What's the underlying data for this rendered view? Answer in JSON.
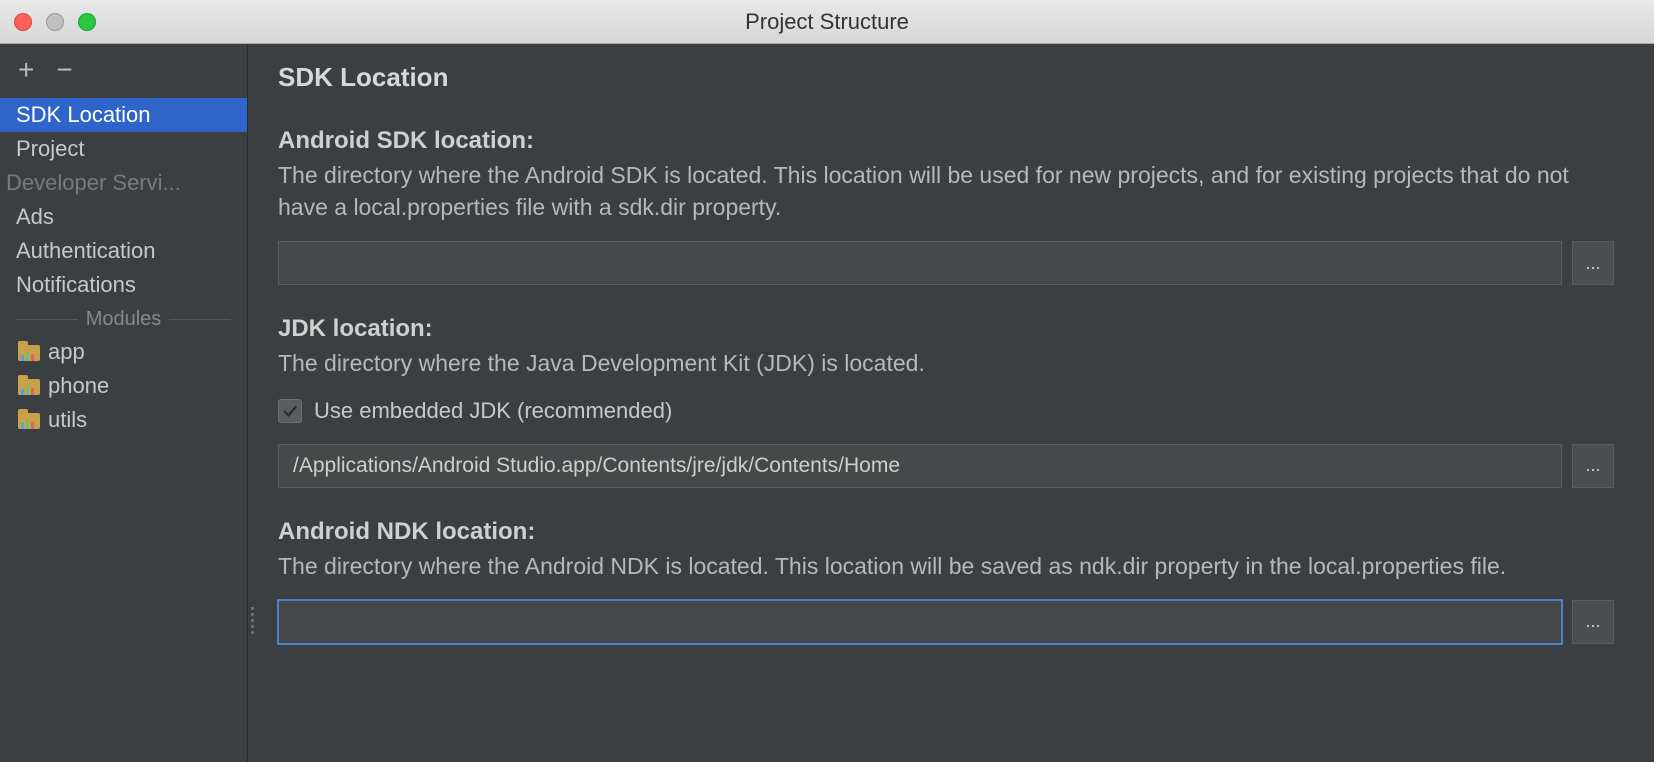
{
  "window": {
    "title": "Project Structure"
  },
  "sidebar": {
    "items": [
      {
        "label": "SDK Location",
        "selected": true
      },
      {
        "label": "Project",
        "selected": false
      }
    ],
    "section_developer_services": "Developer Servi...",
    "dev_items": [
      {
        "label": "Ads"
      },
      {
        "label": "Authentication"
      },
      {
        "label": "Notifications"
      }
    ],
    "modules_header": "Modules",
    "modules": [
      {
        "label": "app"
      },
      {
        "label": "phone"
      },
      {
        "label": "utils"
      }
    ]
  },
  "main": {
    "heading": "SDK Location",
    "sdk": {
      "label": "Android SDK location:",
      "desc": "The directory where the Android SDK is located. This location will be used for new projects, and for existing projects that do not have a local.properties file with a sdk.dir property.",
      "value": "",
      "browse": "..."
    },
    "jdk": {
      "label": "JDK location:",
      "desc": "The directory where the Java Development Kit (JDK) is located.",
      "checkbox_label": "Use embedded JDK (recommended)",
      "checkbox_checked": true,
      "value": "/Applications/Android Studio.app/Contents/jre/jdk/Contents/Home",
      "browse": "..."
    },
    "ndk": {
      "label": "Android NDK location:",
      "desc": "The directory where the Android NDK is located. This location will be saved as ndk.dir property in the local.properties file.",
      "value": "",
      "browse": "..."
    }
  }
}
